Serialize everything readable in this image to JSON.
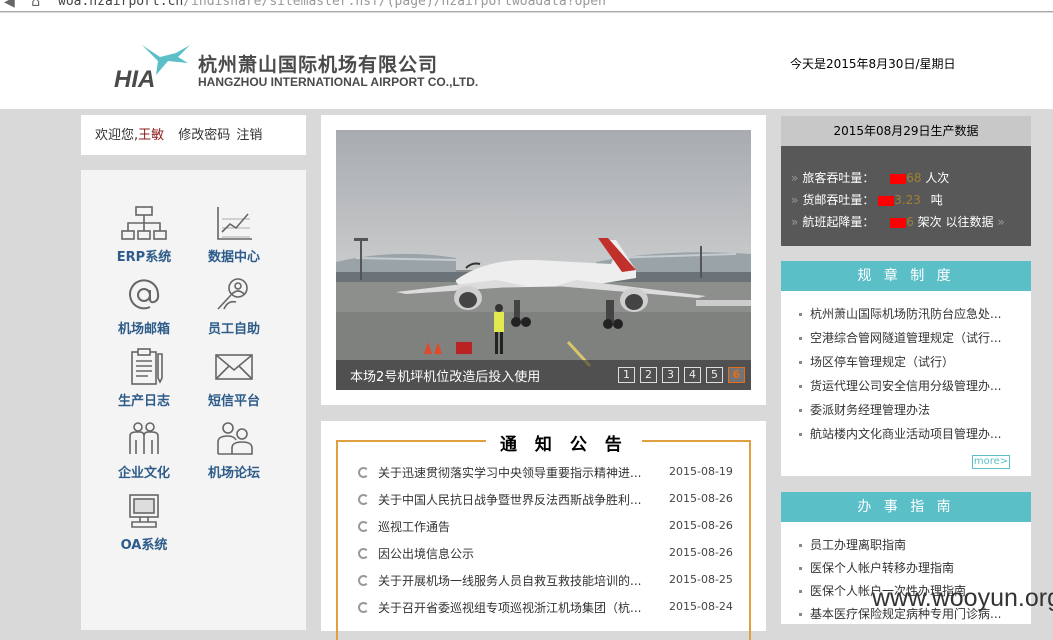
{
  "browser": {
    "url_host": "woa.hzairport.cn",
    "url_path": "/indishare/sitemaster.nsf/(page)/hzairportwoadata?open"
  },
  "header": {
    "logo_cn": "杭州萧山国际机场有限公司",
    "logo_en": "HANGZHOU INTERNATIONAL AIRPORT CO.,LTD.",
    "logo_mark": "HIA",
    "date": "今天是2015年8月30日/星期日"
  },
  "welcome": {
    "greeting": "欢迎您,",
    "user": "王敏",
    "change_pw": "修改密码",
    "logout": "注销"
  },
  "nav": [
    {
      "label": "ERP系统",
      "icon": "org-chart-icon"
    },
    {
      "label": "数据中心",
      "icon": "data-chart-icon"
    },
    {
      "label": "机场邮箱",
      "icon": "at-sign-icon"
    },
    {
      "label": "员工自助",
      "icon": "user-search-icon"
    },
    {
      "label": "生产日志",
      "icon": "clipboard-icon"
    },
    {
      "label": "短信平台",
      "icon": "envelope-icon"
    },
    {
      "label": "企业文化",
      "icon": "people-icon"
    },
    {
      "label": "机场论坛",
      "icon": "forum-icon"
    },
    {
      "label": "OA系统",
      "icon": "monitor-icon"
    }
  ],
  "slider": {
    "caption": "本场2号机坪机位改造后投入使用",
    "pages": [
      "1",
      "2",
      "3",
      "4",
      "5",
      "6"
    ],
    "active": "6"
  },
  "notice": {
    "title": "通 知 公 告",
    "items": [
      {
        "text": "关于迅速贯彻落实学习中央领导重要指示精神进...",
        "date": "2015-08-19"
      },
      {
        "text": "关于中国人民抗日战争暨世界反法西斯战争胜利...",
        "date": "2015-08-26"
      },
      {
        "text": "巡视工作通告",
        "date": "2015-08-26"
      },
      {
        "text": "因公出境信息公示",
        "date": "2015-08-26"
      },
      {
        "text": "关于开展机场一线服务人员自救互救技能培训的...",
        "date": "2015-08-25"
      },
      {
        "text": "关于召开省委巡视组专项巡视浙江机场集团（杭...",
        "date": "2015-08-24"
      }
    ]
  },
  "production": {
    "title": "2015年08月29日生产数据",
    "rows": [
      {
        "label": "旅客吞吐量：",
        "value_visible": "68",
        "unit": "人次"
      },
      {
        "label": "货邮吞吐量：",
        "value_visible": "3.23",
        "unit": "吨"
      },
      {
        "label": "航班起降量：",
        "value_visible": "6",
        "unit": "架次",
        "extra": "以往数据"
      }
    ]
  },
  "rules": {
    "title": "规 章 制 度",
    "items": [
      "杭州萧山国际机场防汛防台应急处...",
      "空港综合管网隧道管理规定（试行...",
      "场区停车管理规定（试行）",
      "货运代理公司安全信用分级管理办...",
      "委派财务经理管理办法",
      "航站楼内文化商业活动项目管理办..."
    ],
    "more": "more>"
  },
  "guide": {
    "title": "办 事 指 南",
    "items": [
      "员工办理离职指南",
      "医保个人帐户转移办理指南",
      "医保个人帐户一次性办理指南",
      "基本医疗保险规定病种专用门诊病..."
    ]
  },
  "watermark": "www.wooyun.org",
  "colors": {
    "accent_teal": "#5bbfc8",
    "notice_border": "#e0a040",
    "nav_text": "#2e5c8a",
    "redact": "#ff0000"
  }
}
